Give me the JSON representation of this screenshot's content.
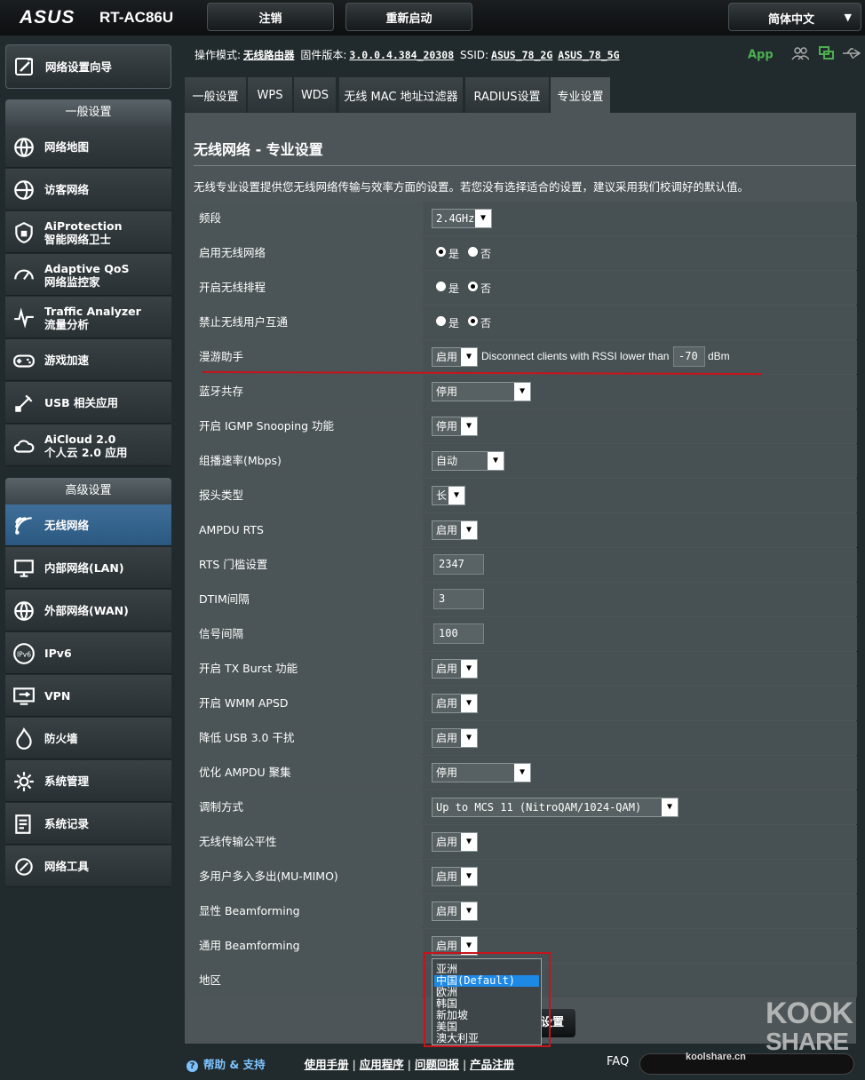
{
  "header": {
    "logo": "ASUS",
    "model": "RT-AC86U",
    "logout": "注销",
    "reboot": "重新启动",
    "language": "简体中文"
  },
  "sidebar": {
    "wizard": "网络设置向导",
    "general_title": "一般设置",
    "general_items": [
      {
        "line1": "网络地图",
        "line2": "",
        "icon": "globe-map-icon"
      },
      {
        "line1": "访客网络",
        "line2": "",
        "icon": "guest-globe-icon"
      },
      {
        "line1": "AiProtection",
        "line2": "智能网络卫士",
        "icon": "shield-icon"
      },
      {
        "line1": "Adaptive QoS",
        "line2": "网络监控家",
        "icon": "gauge-icon"
      },
      {
        "line1": "Traffic Analyzer",
        "line2": "流量分析",
        "icon": "pulse-icon"
      },
      {
        "line1": "游戏加速",
        "line2": "",
        "icon": "gamepad-icon"
      },
      {
        "line1": "USB 相关应用",
        "line2": "",
        "icon": "usb-icon"
      },
      {
        "line1": "AiCloud 2.0",
        "line2": "个人云 2.0 应用",
        "icon": "cloud-icon"
      }
    ],
    "advanced_title": "高级设置",
    "advanced_items": [
      {
        "label": "无线网络",
        "icon": "wifi-icon",
        "active": true
      },
      {
        "label": "内部网络(LAN)",
        "icon": "lan-icon",
        "active": false
      },
      {
        "label": "外部网络(WAN)",
        "icon": "wan-globe-icon",
        "active": false
      },
      {
        "label": "IPv6",
        "icon": "ipv6-icon",
        "active": false
      },
      {
        "label": "VPN",
        "icon": "vpn-icon",
        "active": false
      },
      {
        "label": "防火墙",
        "icon": "firewall-icon",
        "active": false
      },
      {
        "label": "系统管理",
        "icon": "admin-icon",
        "active": false
      },
      {
        "label": "系统记录",
        "icon": "log-icon",
        "active": false
      },
      {
        "label": "网络工具",
        "icon": "tools-icon",
        "active": false
      }
    ]
  },
  "status": {
    "mode_label": "操作模式:",
    "mode_value": "无线路由器",
    "firmware_label": "固件版本:",
    "firmware_value": "3.0.0.4.384_20308",
    "ssid_label": "SSID:",
    "ssid_2g": "ASUS_78_2G",
    "ssid_5g": "ASUS_78_5G",
    "app": "App"
  },
  "tabs": [
    "一般设置",
    "WPS",
    "WDS",
    "无线 MAC 地址过滤器",
    "RADIUS设置",
    "专业设置"
  ],
  "page": {
    "title": "无线网络 - 专业设置",
    "description": "无线专业设置提供您无线网络传输与效率方面的设置。若您没有选择适合的设置，建议采用我们校调好的默认值。"
  },
  "settings": [
    {
      "label": "频段",
      "type": "select",
      "value": "2.4GHz"
    },
    {
      "label": "启用无线网络",
      "type": "radio",
      "yes": "是",
      "no": "否",
      "selected": "yes"
    },
    {
      "label": "开启无线排程",
      "type": "radio",
      "yes": "是",
      "no": "否",
      "selected": "no"
    },
    {
      "label": "禁止无线用户互通",
      "type": "radio",
      "yes": "是",
      "no": "否",
      "selected": "no"
    },
    {
      "label": "漫游助手",
      "type": "roaming",
      "value": "启用",
      "text": "Disconnect clients with RSSI lower than",
      "rssi": "-70",
      "unit": "dBm"
    },
    {
      "label": "蓝牙共存",
      "type": "select",
      "value": "停用"
    },
    {
      "label": "开启 IGMP Snooping 功能",
      "type": "select",
      "value": "停用"
    },
    {
      "label": "组播速率(Mbps)",
      "type": "select",
      "value": "自动"
    },
    {
      "label": "报头类型",
      "type": "select",
      "value": "长"
    },
    {
      "label": "AMPDU RTS",
      "type": "select",
      "value": "启用"
    },
    {
      "label": "RTS 门槛设置",
      "type": "text",
      "value": "2347"
    },
    {
      "label": "DTIM间隔",
      "type": "text",
      "value": "3"
    },
    {
      "label": "信号间隔",
      "type": "text",
      "value": "100"
    },
    {
      "label": "开启 TX Burst 功能",
      "type": "select",
      "value": "启用"
    },
    {
      "label": "开启 WMM APSD",
      "type": "select",
      "value": "启用"
    },
    {
      "label": "降低 USB 3.0 干扰",
      "type": "select",
      "value": "启用"
    },
    {
      "label": "优化 AMPDU 聚集",
      "type": "select",
      "value": "停用"
    },
    {
      "label": "调制方式",
      "type": "select",
      "value": "Up to MCS 11 (NitroQAM/1024-QAM)"
    },
    {
      "label": "无线传输公平性",
      "type": "select",
      "value": "启用"
    },
    {
      "label": "多用户多入多出(MU-MIMO)",
      "type": "select",
      "value": "启用"
    },
    {
      "label": "显性 Beamforming",
      "type": "select",
      "value": "启用"
    },
    {
      "label": "通用 Beamforming",
      "type": "select",
      "value": "启用"
    },
    {
      "label": "地区",
      "type": "none",
      "value": ""
    }
  ],
  "region_dropdown": {
    "options": [
      "亚洲",
      "中国(Default)",
      "欧洲",
      "韩国",
      "新加坡",
      "美国",
      "澳大利亚"
    ],
    "selected_index": 1
  },
  "apply_button": "设置",
  "footer": {
    "help": "帮助 & 支持",
    "links": [
      "使用手册",
      "应用程序",
      "问题回报",
      "产品注册"
    ],
    "faq": "FAQ"
  },
  "watermark": {
    "line1": "KOOK",
    "line2": "SHARE",
    "site": "koolshare.cn"
  },
  "colors": {
    "accent_red": "#c8131b",
    "active_menu": "#3f6f99",
    "panel": "#4d5558",
    "link_blue": "#7dc4ff"
  }
}
